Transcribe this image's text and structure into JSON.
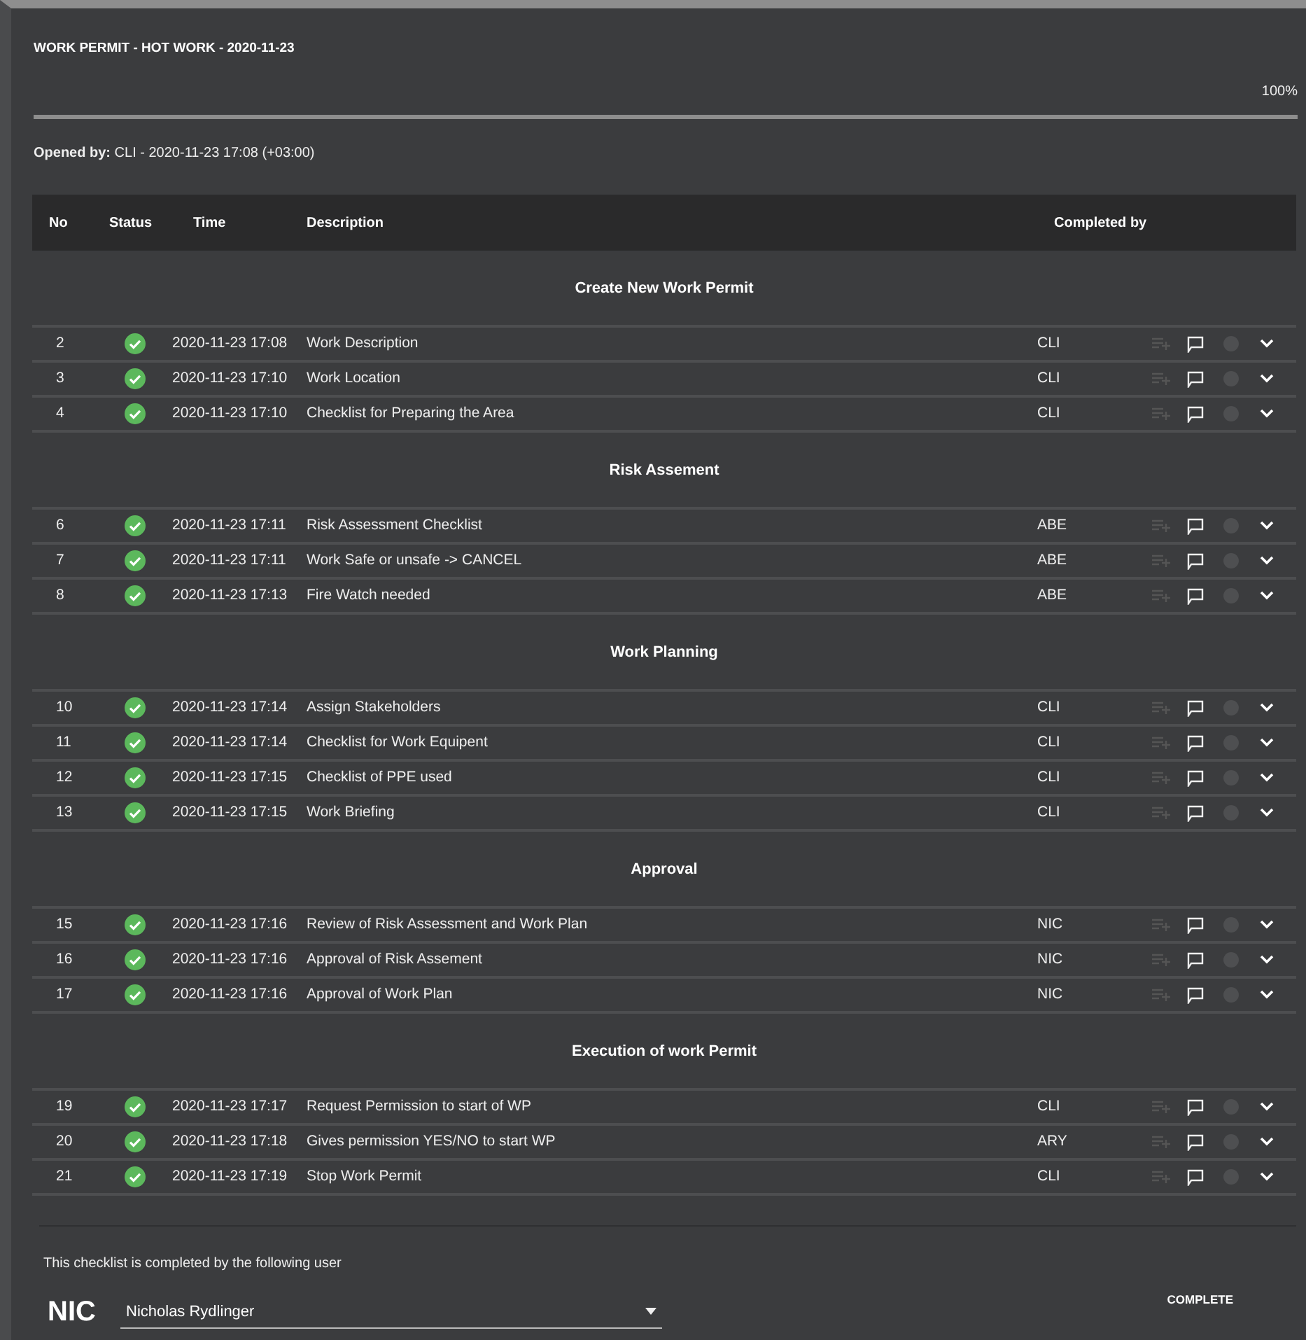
{
  "title": "WORK PERMIT - HOT WORK - 2020-11-23",
  "progress": {
    "level": 1,
    "label": "100%"
  },
  "opened_by": {
    "label": "Opened by:",
    "value": "CLI - 2020-11-23 17:08 (+03:00)"
  },
  "columns": [
    "No",
    "Status",
    "Time",
    "Description",
    "Completed by"
  ],
  "sections": [
    {
      "title": "Create New Work Permit",
      "rows": [
        {
          "no": "2",
          "completed": true,
          "time": "2020-11-23 17:08",
          "description": "Work Description",
          "completed_by": "CLI"
        },
        {
          "no": "3",
          "completed": true,
          "time": "2020-11-23 17:10",
          "description": "Work Location",
          "completed_by": "CLI"
        },
        {
          "no": "4",
          "completed": true,
          "time": "2020-11-23 17:10",
          "description": "Checklist for Preparing the Area",
          "completed_by": "CLI"
        }
      ]
    },
    {
      "title": "Risk Assement",
      "rows": [
        {
          "no": "6",
          "completed": true,
          "time": "2020-11-23 17:11",
          "description": "Risk Assessment Checklist",
          "completed_by": "ABE"
        },
        {
          "no": "7",
          "completed": true,
          "time": "2020-11-23 17:11",
          "description": "Work Safe or unsafe -> CANCEL",
          "completed_by": "ABE"
        },
        {
          "no": "8",
          "completed": true,
          "time": "2020-11-23 17:13",
          "description": "Fire Watch needed",
          "completed_by": "ABE"
        }
      ]
    },
    {
      "title": "Work Planning",
      "rows": [
        {
          "no": "10",
          "completed": true,
          "time": "2020-11-23 17:14",
          "description": "Assign Stakeholders",
          "completed_by": "CLI"
        },
        {
          "no": "11",
          "completed": true,
          "time": "2020-11-23 17:14",
          "description": "Checklist for Work Equipent",
          "completed_by": "CLI"
        },
        {
          "no": "12",
          "completed": true,
          "time": "2020-11-23 17:15",
          "description": "Checklist of PPE used",
          "completed_by": "CLI"
        },
        {
          "no": "13",
          "completed": true,
          "time": "2020-11-23 17:15",
          "description": "Work Briefing",
          "completed_by": "CLI"
        }
      ]
    },
    {
      "title": "Approval",
      "rows": [
        {
          "no": "15",
          "completed": true,
          "time": "2020-11-23 17:16",
          "description": "Review of Risk Assessment and Work Plan",
          "completed_by": "NIC"
        },
        {
          "no": "16",
          "completed": true,
          "time": "2020-11-23 17:16",
          "description": "Approval of Risk Assement",
          "completed_by": "NIC"
        },
        {
          "no": "17",
          "completed": true,
          "time": "2020-11-23 17:16",
          "description": "Approval of Work Plan",
          "completed_by": "NIC"
        }
      ]
    },
    {
      "title": "Execution of work Permit",
      "rows": [
        {
          "no": "19",
          "completed": true,
          "time": "2020-11-23 17:17",
          "description": "Request Permission to start of WP",
          "completed_by": "CLI"
        },
        {
          "no": "20",
          "completed": true,
          "time": "2020-11-23 17:18",
          "description": "Gives permission YES/NO to start WP",
          "completed_by": "ARY"
        },
        {
          "no": "21",
          "completed": true,
          "time": "2020-11-23 17:19",
          "description": "Stop Work Permit",
          "completed_by": "CLI"
        }
      ]
    }
  ],
  "footer": {
    "note": "This checklist is completed by the following user",
    "user_code": "NIC",
    "user": "Nicholas Rydlinger",
    "button": "COMPLETE"
  }
}
